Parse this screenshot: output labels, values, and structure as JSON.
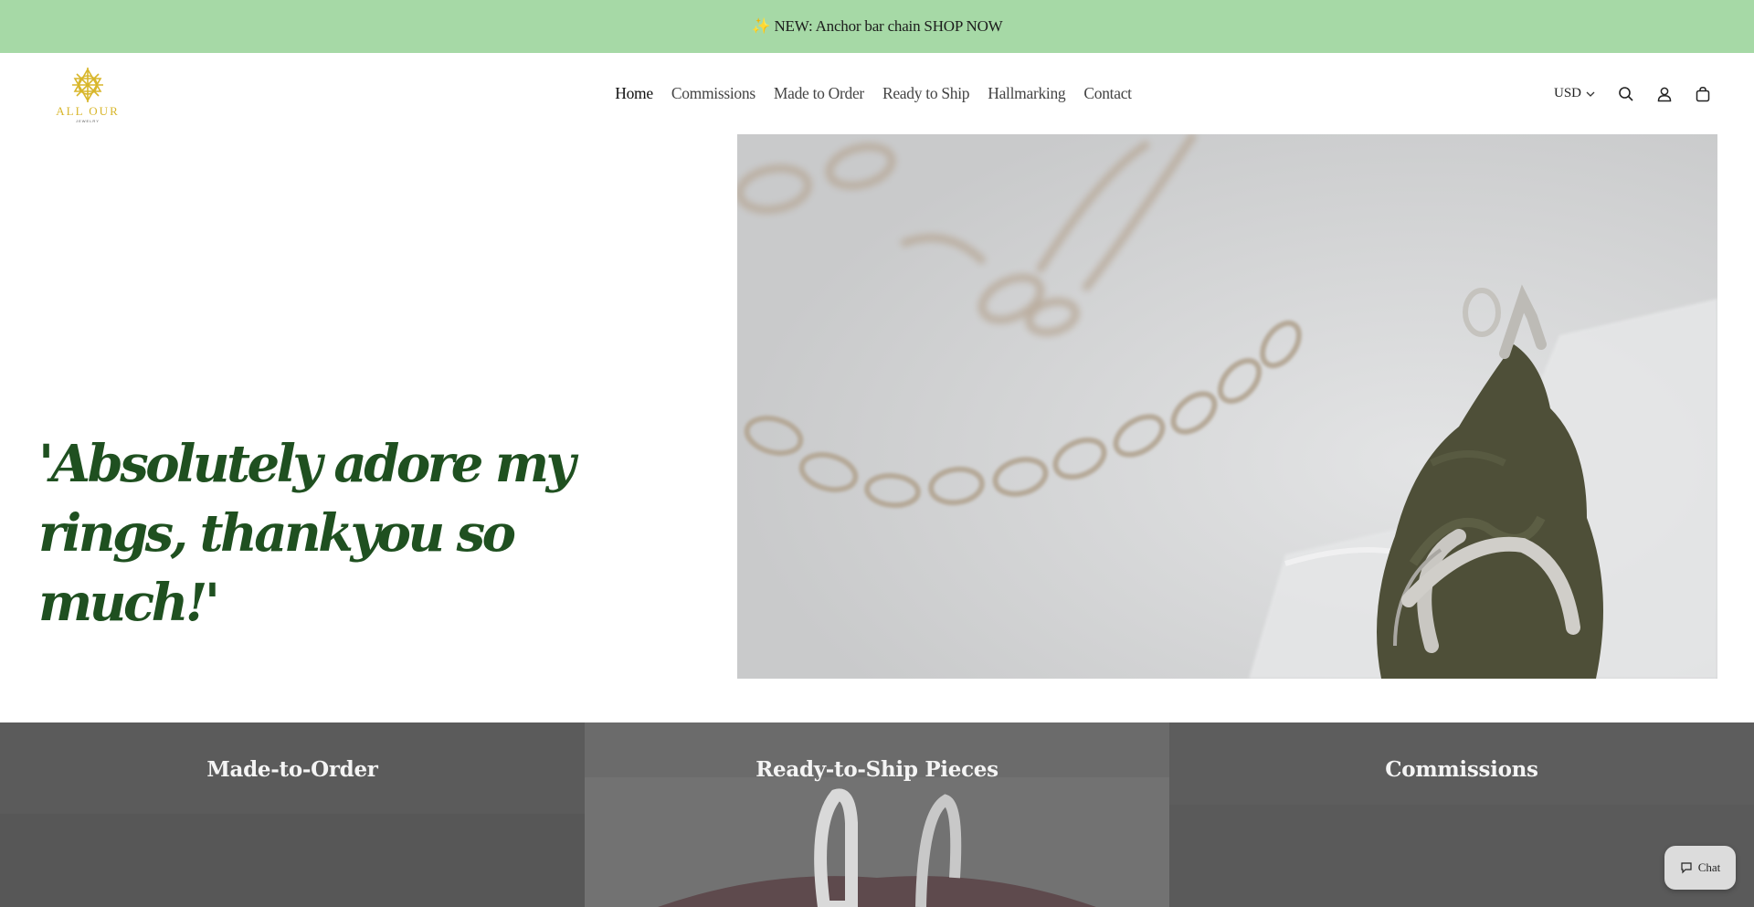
{
  "announcement": {
    "icon": "sparkles-icon",
    "text": "✨ NEW: Anchor bar chain SHOP NOW"
  },
  "header": {
    "logo_text": "ALL OUR",
    "logo_subtext": "JEWELRY"
  },
  "nav": {
    "items": [
      {
        "label": "Home"
      },
      {
        "label": "Commissions"
      },
      {
        "label": "Made to Order"
      },
      {
        "label": "Ready to Ship"
      },
      {
        "label": "Hallmarking"
      },
      {
        "label": "Contact"
      }
    ]
  },
  "tools": {
    "currency": "USD",
    "icons": [
      "search-icon",
      "account-icon",
      "cart-icon"
    ]
  },
  "hero": {
    "quote": "'Absolutely adore my rings, thankyou so much!'"
  },
  "collections": [
    {
      "title": "Made-to-Order"
    },
    {
      "title": "Ready-to-Ship Pieces"
    },
    {
      "title": "Commissions"
    }
  ],
  "chat": {
    "label": "Chat"
  },
  "colors": {
    "announcement_bg": "#a6d9a6",
    "quote_green": "#1f5020",
    "logo_gold": "#d8b62a"
  }
}
